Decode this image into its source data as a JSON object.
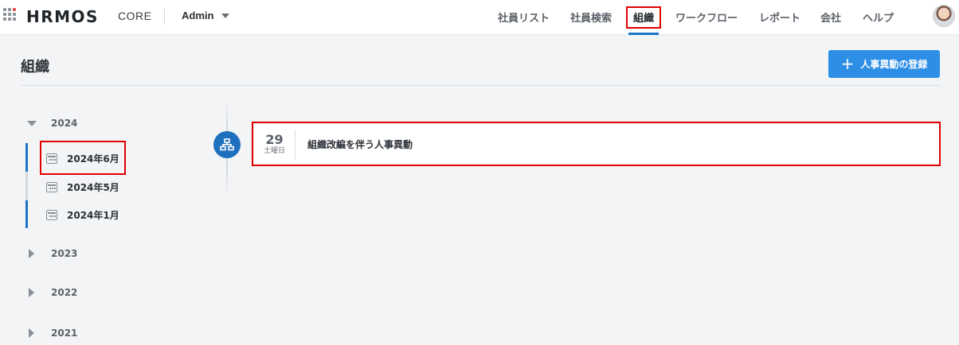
{
  "header": {
    "logo": "HRMOS",
    "product": "CORE",
    "account": "Admin",
    "nav": [
      {
        "label": "社員リスト"
      },
      {
        "label": "社員検索"
      },
      {
        "label": "組織"
      },
      {
        "label": "ワークフロー"
      },
      {
        "label": "レポート"
      },
      {
        "label": "会社"
      },
      {
        "label": "ヘルプ"
      }
    ],
    "active_nav": "組織"
  },
  "page": {
    "title": "組織",
    "add_button_label": "人事異動の登録"
  },
  "sidebar": {
    "years": [
      {
        "label": "2024",
        "expanded": true,
        "months": [
          {
            "label": "2024年6月",
            "selected": true
          },
          {
            "label": "2024年5月"
          },
          {
            "label": "2024年1月"
          }
        ]
      },
      {
        "label": "2023",
        "expanded": false
      },
      {
        "label": "2022",
        "expanded": false
      },
      {
        "label": "2021",
        "expanded": false
      }
    ]
  },
  "timeline": {
    "events": [
      {
        "day": "29",
        "weekday": "土曜日",
        "title": "組織改編を伴う人事異動"
      }
    ]
  },
  "colors": {
    "accent": "#1a73c8",
    "button": "#2d8ee6",
    "highlight": "#e00000",
    "background": "#f3f4f6"
  },
  "icons": {
    "app_grid": "app-grid-icon",
    "caret": "chevron-down-icon",
    "add": "plus-icon",
    "calendar": "calendar-icon",
    "org": "org-chart-icon"
  }
}
